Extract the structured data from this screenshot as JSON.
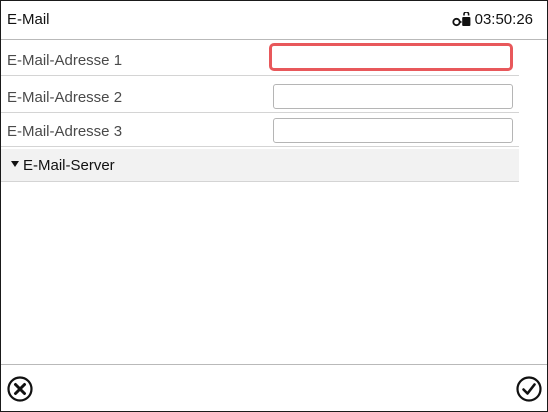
{
  "header": {
    "title": "E-Mail",
    "time": "03:50:26",
    "lock_icon": "lock-key-icon"
  },
  "fields": [
    {
      "label": "E-Mail-Adresse 1",
      "value": "",
      "focused": true
    },
    {
      "label": "E-Mail-Adresse 2",
      "value": ""
    },
    {
      "label": "E-Mail-Adresse 3",
      "value": ""
    }
  ],
  "section": {
    "label": "E-Mail-Server",
    "expanded": true
  },
  "footer": {
    "cancel_icon": "circle-x-icon",
    "confirm_icon": "circle-check-icon"
  },
  "colors": {
    "focus_border": "#e8585b",
    "section_bg": "#f2f2f2"
  }
}
